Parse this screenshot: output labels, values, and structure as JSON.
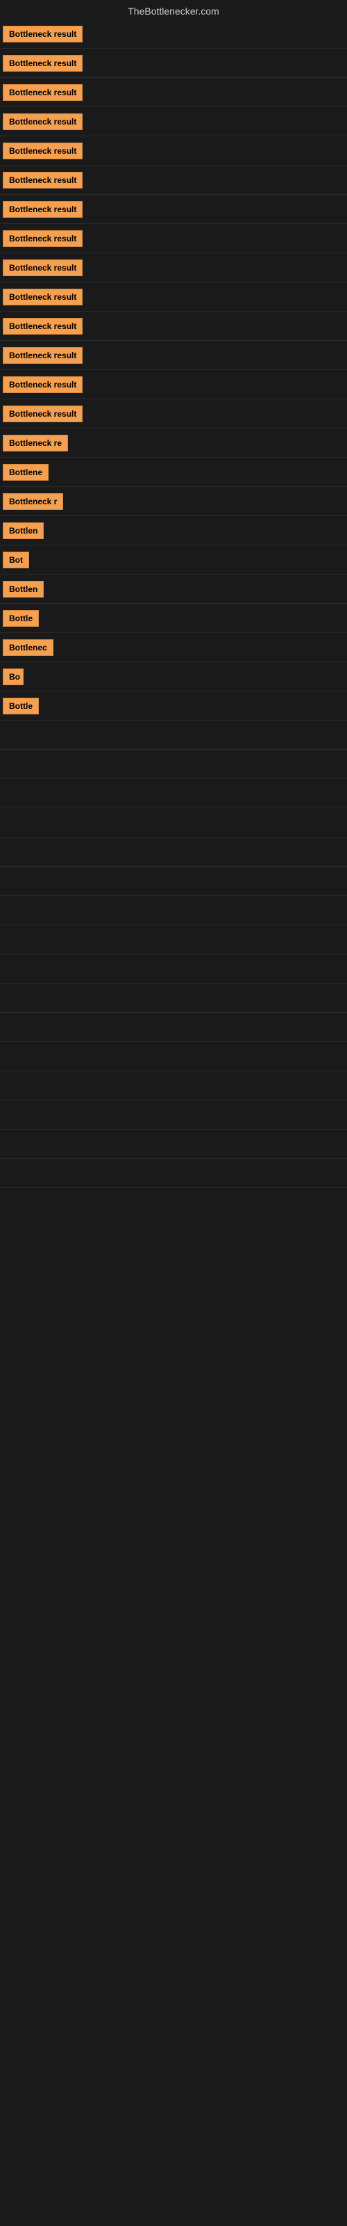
{
  "site": {
    "title": "TheBottlenecker.com"
  },
  "rows": [
    {
      "id": 1,
      "label": "Bottleneck result",
      "width": 130,
      "visible": true
    },
    {
      "id": 2,
      "label": "Bottleneck result",
      "width": 130,
      "visible": true
    },
    {
      "id": 3,
      "label": "Bottleneck result",
      "width": 130,
      "visible": true
    },
    {
      "id": 4,
      "label": "Bottleneck result",
      "width": 130,
      "visible": true
    },
    {
      "id": 5,
      "label": "Bottleneck result",
      "width": 130,
      "visible": true
    },
    {
      "id": 6,
      "label": "Bottleneck result",
      "width": 130,
      "visible": true
    },
    {
      "id": 7,
      "label": "Bottleneck result",
      "width": 130,
      "visible": true
    },
    {
      "id": 8,
      "label": "Bottleneck result",
      "width": 130,
      "visible": true
    },
    {
      "id": 9,
      "label": "Bottleneck result",
      "width": 130,
      "visible": true
    },
    {
      "id": 10,
      "label": "Bottleneck result",
      "width": 130,
      "visible": true
    },
    {
      "id": 11,
      "label": "Bottleneck result",
      "width": 130,
      "visible": true
    },
    {
      "id": 12,
      "label": "Bottleneck result",
      "width": 130,
      "visible": true
    },
    {
      "id": 13,
      "label": "Bottleneck result",
      "width": 130,
      "visible": true
    },
    {
      "id": 14,
      "label": "Bottleneck result",
      "width": 130,
      "visible": true
    },
    {
      "id": 15,
      "label": "Bottleneck re",
      "width": 100,
      "visible": true
    },
    {
      "id": 16,
      "label": "Bottlene",
      "width": 78,
      "visible": true
    },
    {
      "id": 17,
      "label": "Bottleneck r",
      "width": 90,
      "visible": true
    },
    {
      "id": 18,
      "label": "Bottlen",
      "width": 68,
      "visible": true
    },
    {
      "id": 19,
      "label": "Bot",
      "width": 38,
      "visible": true
    },
    {
      "id": 20,
      "label": "Bottlen",
      "width": 68,
      "visible": true
    },
    {
      "id": 21,
      "label": "Bottle",
      "width": 55,
      "visible": true
    },
    {
      "id": 22,
      "label": "Bottlenec",
      "width": 82,
      "visible": true
    },
    {
      "id": 23,
      "label": "Bo",
      "width": 30,
      "visible": true
    },
    {
      "id": 24,
      "label": "Bottle",
      "width": 55,
      "visible": true
    },
    {
      "id": 25,
      "label": "",
      "width": 0,
      "visible": false
    },
    {
      "id": 26,
      "label": "",
      "width": 0,
      "visible": false
    },
    {
      "id": 27,
      "label": "",
      "width": 0,
      "visible": false
    },
    {
      "id": 28,
      "label": "",
      "width": 0,
      "visible": false
    },
    {
      "id": 29,
      "label": "",
      "width": 0,
      "visible": false
    },
    {
      "id": 30,
      "label": "",
      "width": 0,
      "visible": false
    },
    {
      "id": 31,
      "label": "",
      "width": 0,
      "visible": false
    },
    {
      "id": 32,
      "label": "",
      "width": 0,
      "visible": false
    },
    {
      "id": 33,
      "label": "",
      "width": 0,
      "visible": false
    },
    {
      "id": 34,
      "label": "",
      "width": 0,
      "visible": false
    },
    {
      "id": 35,
      "label": "",
      "width": 0,
      "visible": false
    },
    {
      "id": 36,
      "label": "",
      "width": 0,
      "visible": false
    },
    {
      "id": 37,
      "label": "",
      "width": 0,
      "visible": false
    },
    {
      "id": 38,
      "label": "",
      "width": 0,
      "visible": false
    },
    {
      "id": 39,
      "label": "",
      "width": 0,
      "visible": false
    },
    {
      "id": 40,
      "label": "",
      "width": 0,
      "visible": false
    }
  ]
}
